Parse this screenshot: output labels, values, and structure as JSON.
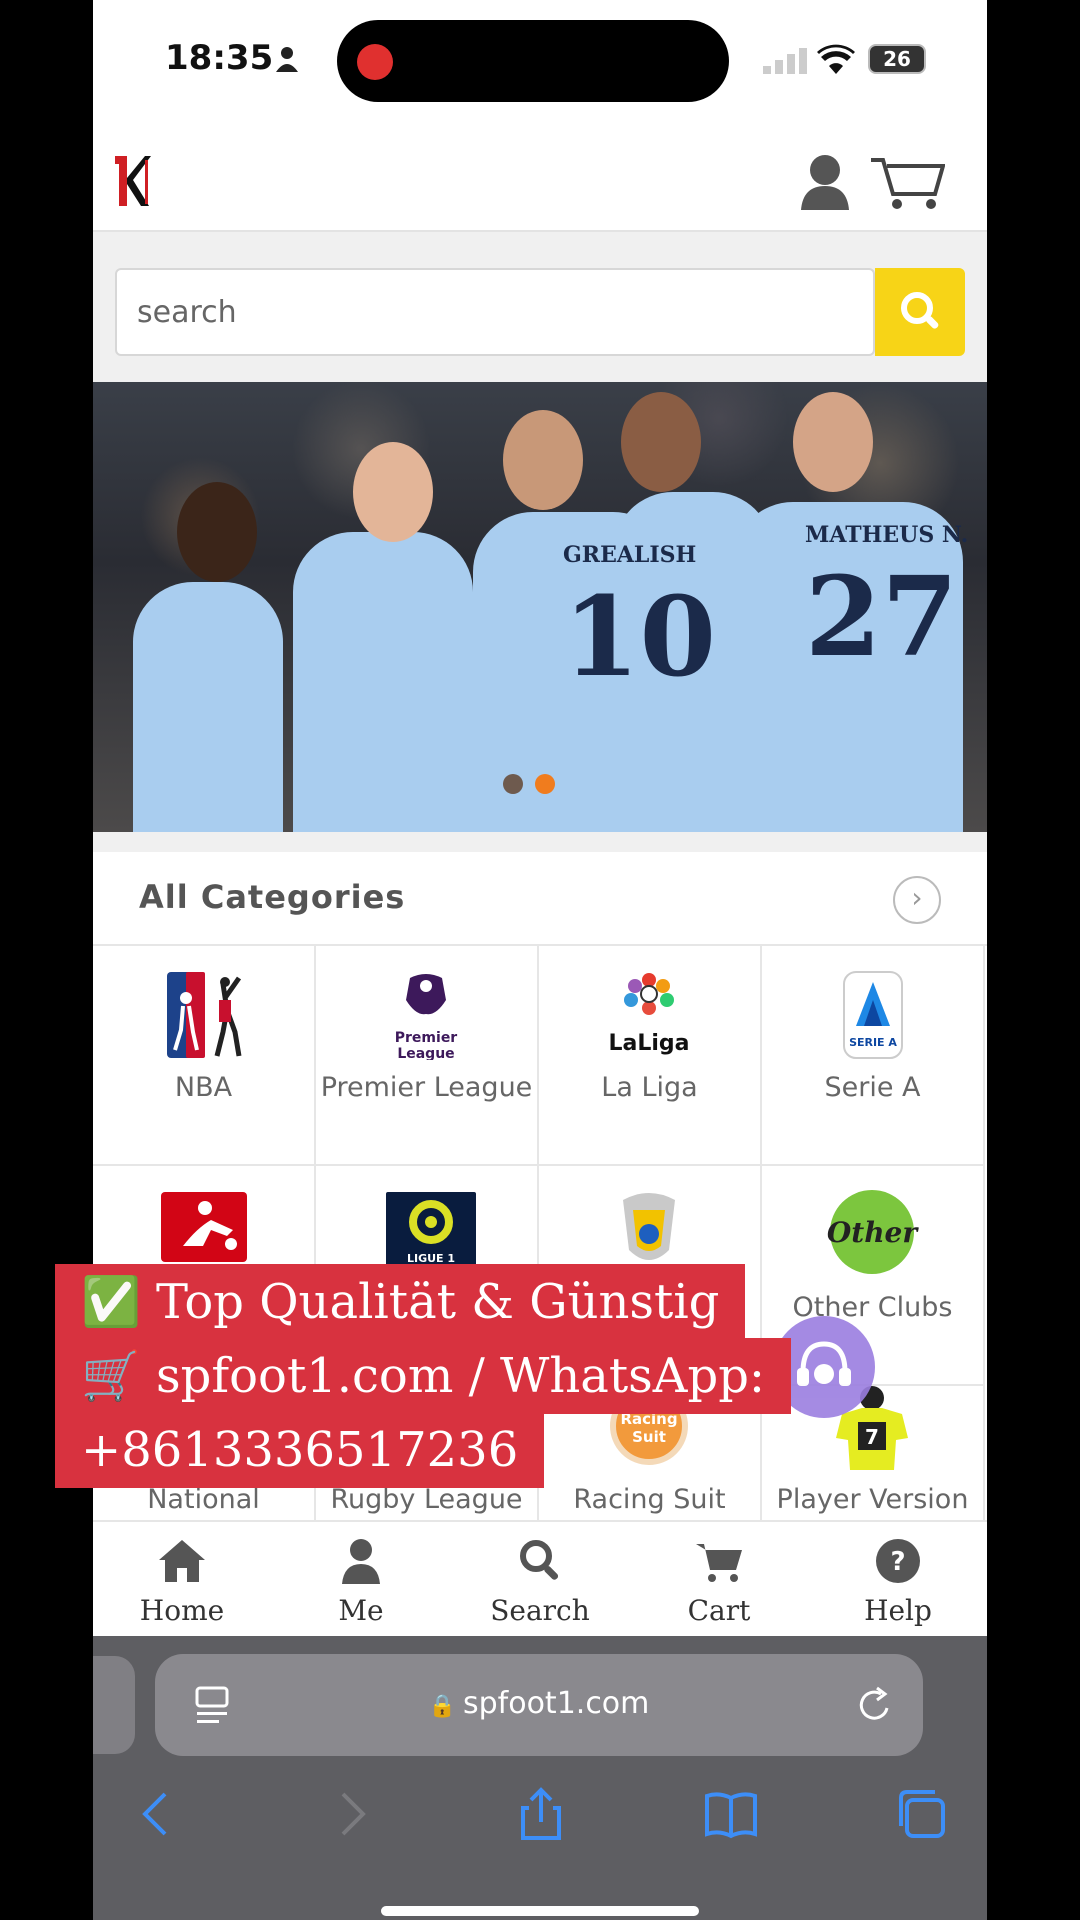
{
  "status_bar": {
    "time": "18:35",
    "battery": "26"
  },
  "search": {
    "placeholder": "search"
  },
  "categories": {
    "title": "All Categories",
    "items": [
      {
        "label": "NBA"
      },
      {
        "label": "Premier League"
      },
      {
        "label": "La Liga"
      },
      {
        "label": "Serie A"
      },
      {
        "label": ""
      },
      {
        "label": ""
      },
      {
        "label": ""
      },
      {
        "label": "Other Clubs"
      },
      {
        "label": "National"
      },
      {
        "label": "Rugby League"
      },
      {
        "label": "Racing Suit"
      },
      {
        "label": "Player Version"
      }
    ],
    "logo_texts": {
      "laliga": "LaLiga",
      "premier": "Premier League",
      "serie_a": "SERIE A",
      "other": "Other",
      "racing": "Racing Suit",
      "ligue1": "LIGUE 1"
    }
  },
  "banner": {
    "jersey_name_1": "GREALISH",
    "jersey_number_1": "10",
    "jersey_name_2": "MATHEUS N.",
    "jersey_number_2": "27"
  },
  "promo": {
    "line1": "✅ Top Qualität & Günstig",
    "line2": "🛒 spfoot1.com / WhatsApp:",
    "line3": "+8613336517236"
  },
  "bottom_nav": [
    {
      "label": "Home",
      "icon": "home-icon"
    },
    {
      "label": "Me",
      "icon": "person-icon"
    },
    {
      "label": "Search",
      "icon": "search-icon"
    },
    {
      "label": "Cart",
      "icon": "cart-icon"
    },
    {
      "label": "Help",
      "icon": "help-icon"
    }
  ],
  "browser": {
    "url": "spfoot1.com"
  },
  "colors": {
    "accent_yellow": "#f7d417",
    "promo_red": "#d8323f",
    "slider_active": "#f07c1e"
  }
}
